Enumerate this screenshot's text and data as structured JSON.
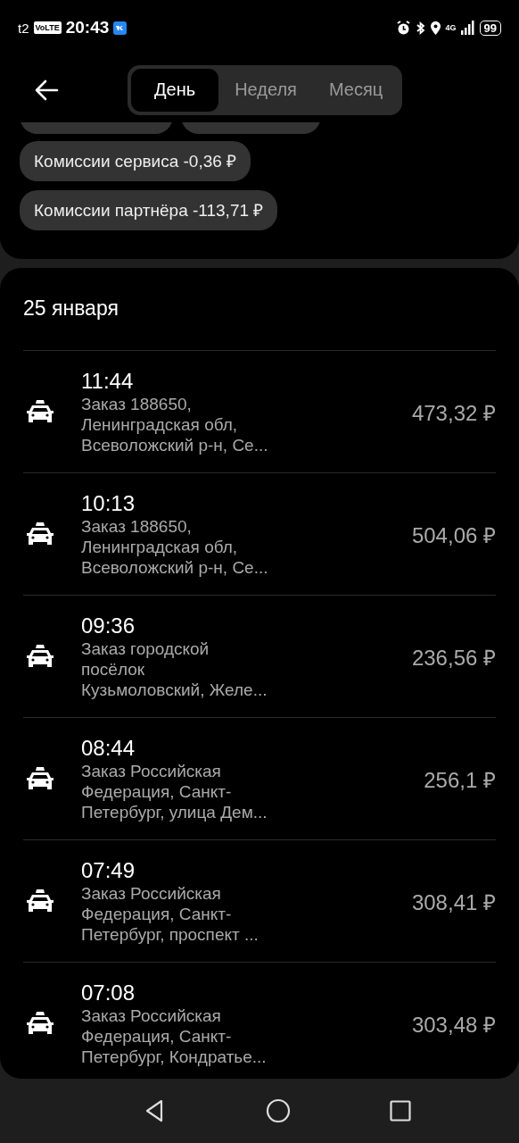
{
  "status_bar": {
    "carrier": "t2",
    "volte": "VoLTE",
    "time": "20:43",
    "network": "4G",
    "battery": "99"
  },
  "tabs": [
    {
      "label": "День",
      "selected": true
    },
    {
      "label": "Неделя",
      "selected": false
    },
    {
      "label": "Месяц",
      "selected": false
    }
  ],
  "chips": [
    "Комиссии сервиса -0,36 ₽",
    "Комиссии партнёра -113,71 ₽"
  ],
  "date": "25 января",
  "orders": [
    {
      "time": "11:44",
      "description": [
        "Заказ 188650,",
        "Ленинградская обл,",
        "Всеволожский р-н, Се..."
      ],
      "amount": "473,32 ₽"
    },
    {
      "time": "10:13",
      "description": [
        "Заказ 188650,",
        "Ленинградская обл,",
        "Всеволожский р-н, Се..."
      ],
      "amount": "504,06 ₽"
    },
    {
      "time": "09:36",
      "description": [
        "Заказ городской",
        "посёлок",
        "Кузьмоловский, Желе..."
      ],
      "amount": "236,56 ₽"
    },
    {
      "time": "08:44",
      "description": [
        "Заказ Российская",
        "Федерация, Санкт-",
        "Петербург, улица Дем..."
      ],
      "amount": "256,1 ₽"
    },
    {
      "time": "07:49",
      "description": [
        "Заказ Российская",
        "Федерация, Санкт-",
        "Петербург, проспект ..."
      ],
      "amount": "308,41 ₽"
    },
    {
      "time": "07:08",
      "description": [
        "Заказ Российская",
        "Федерация, Санкт-",
        "Петербург, Кондратье..."
      ],
      "amount": "303,48 ₽"
    }
  ]
}
